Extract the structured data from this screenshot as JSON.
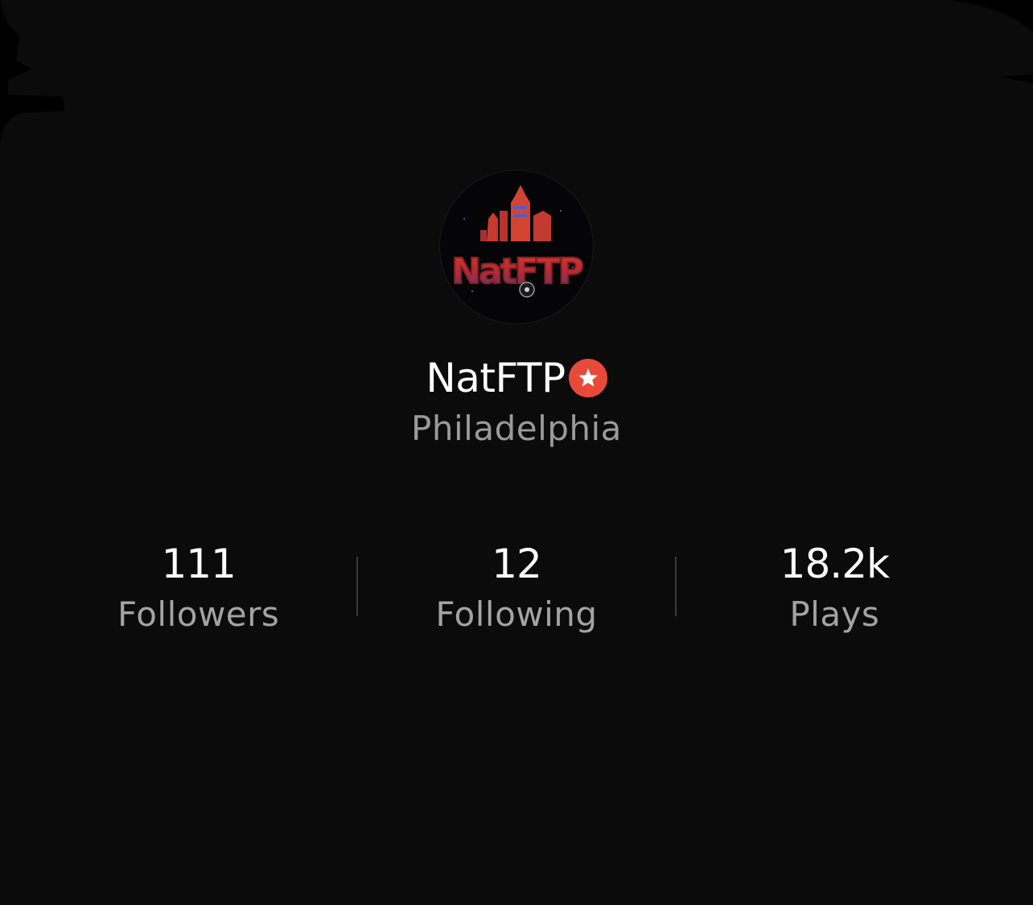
{
  "profile": {
    "username": "NatFTP",
    "location": "Philadelphia",
    "verified_badge_icon": "star-badge-icon",
    "avatar_logo_text": "NatFTP"
  },
  "stats": [
    {
      "value": "111",
      "label": "Followers"
    },
    {
      "value": "12",
      "label": "Following"
    },
    {
      "value": "18.2k",
      "label": "Plays"
    }
  ],
  "colors": {
    "background": "#0b0b0b",
    "badge": "#e84a3a",
    "secondary_text": "#9a9a9a"
  }
}
